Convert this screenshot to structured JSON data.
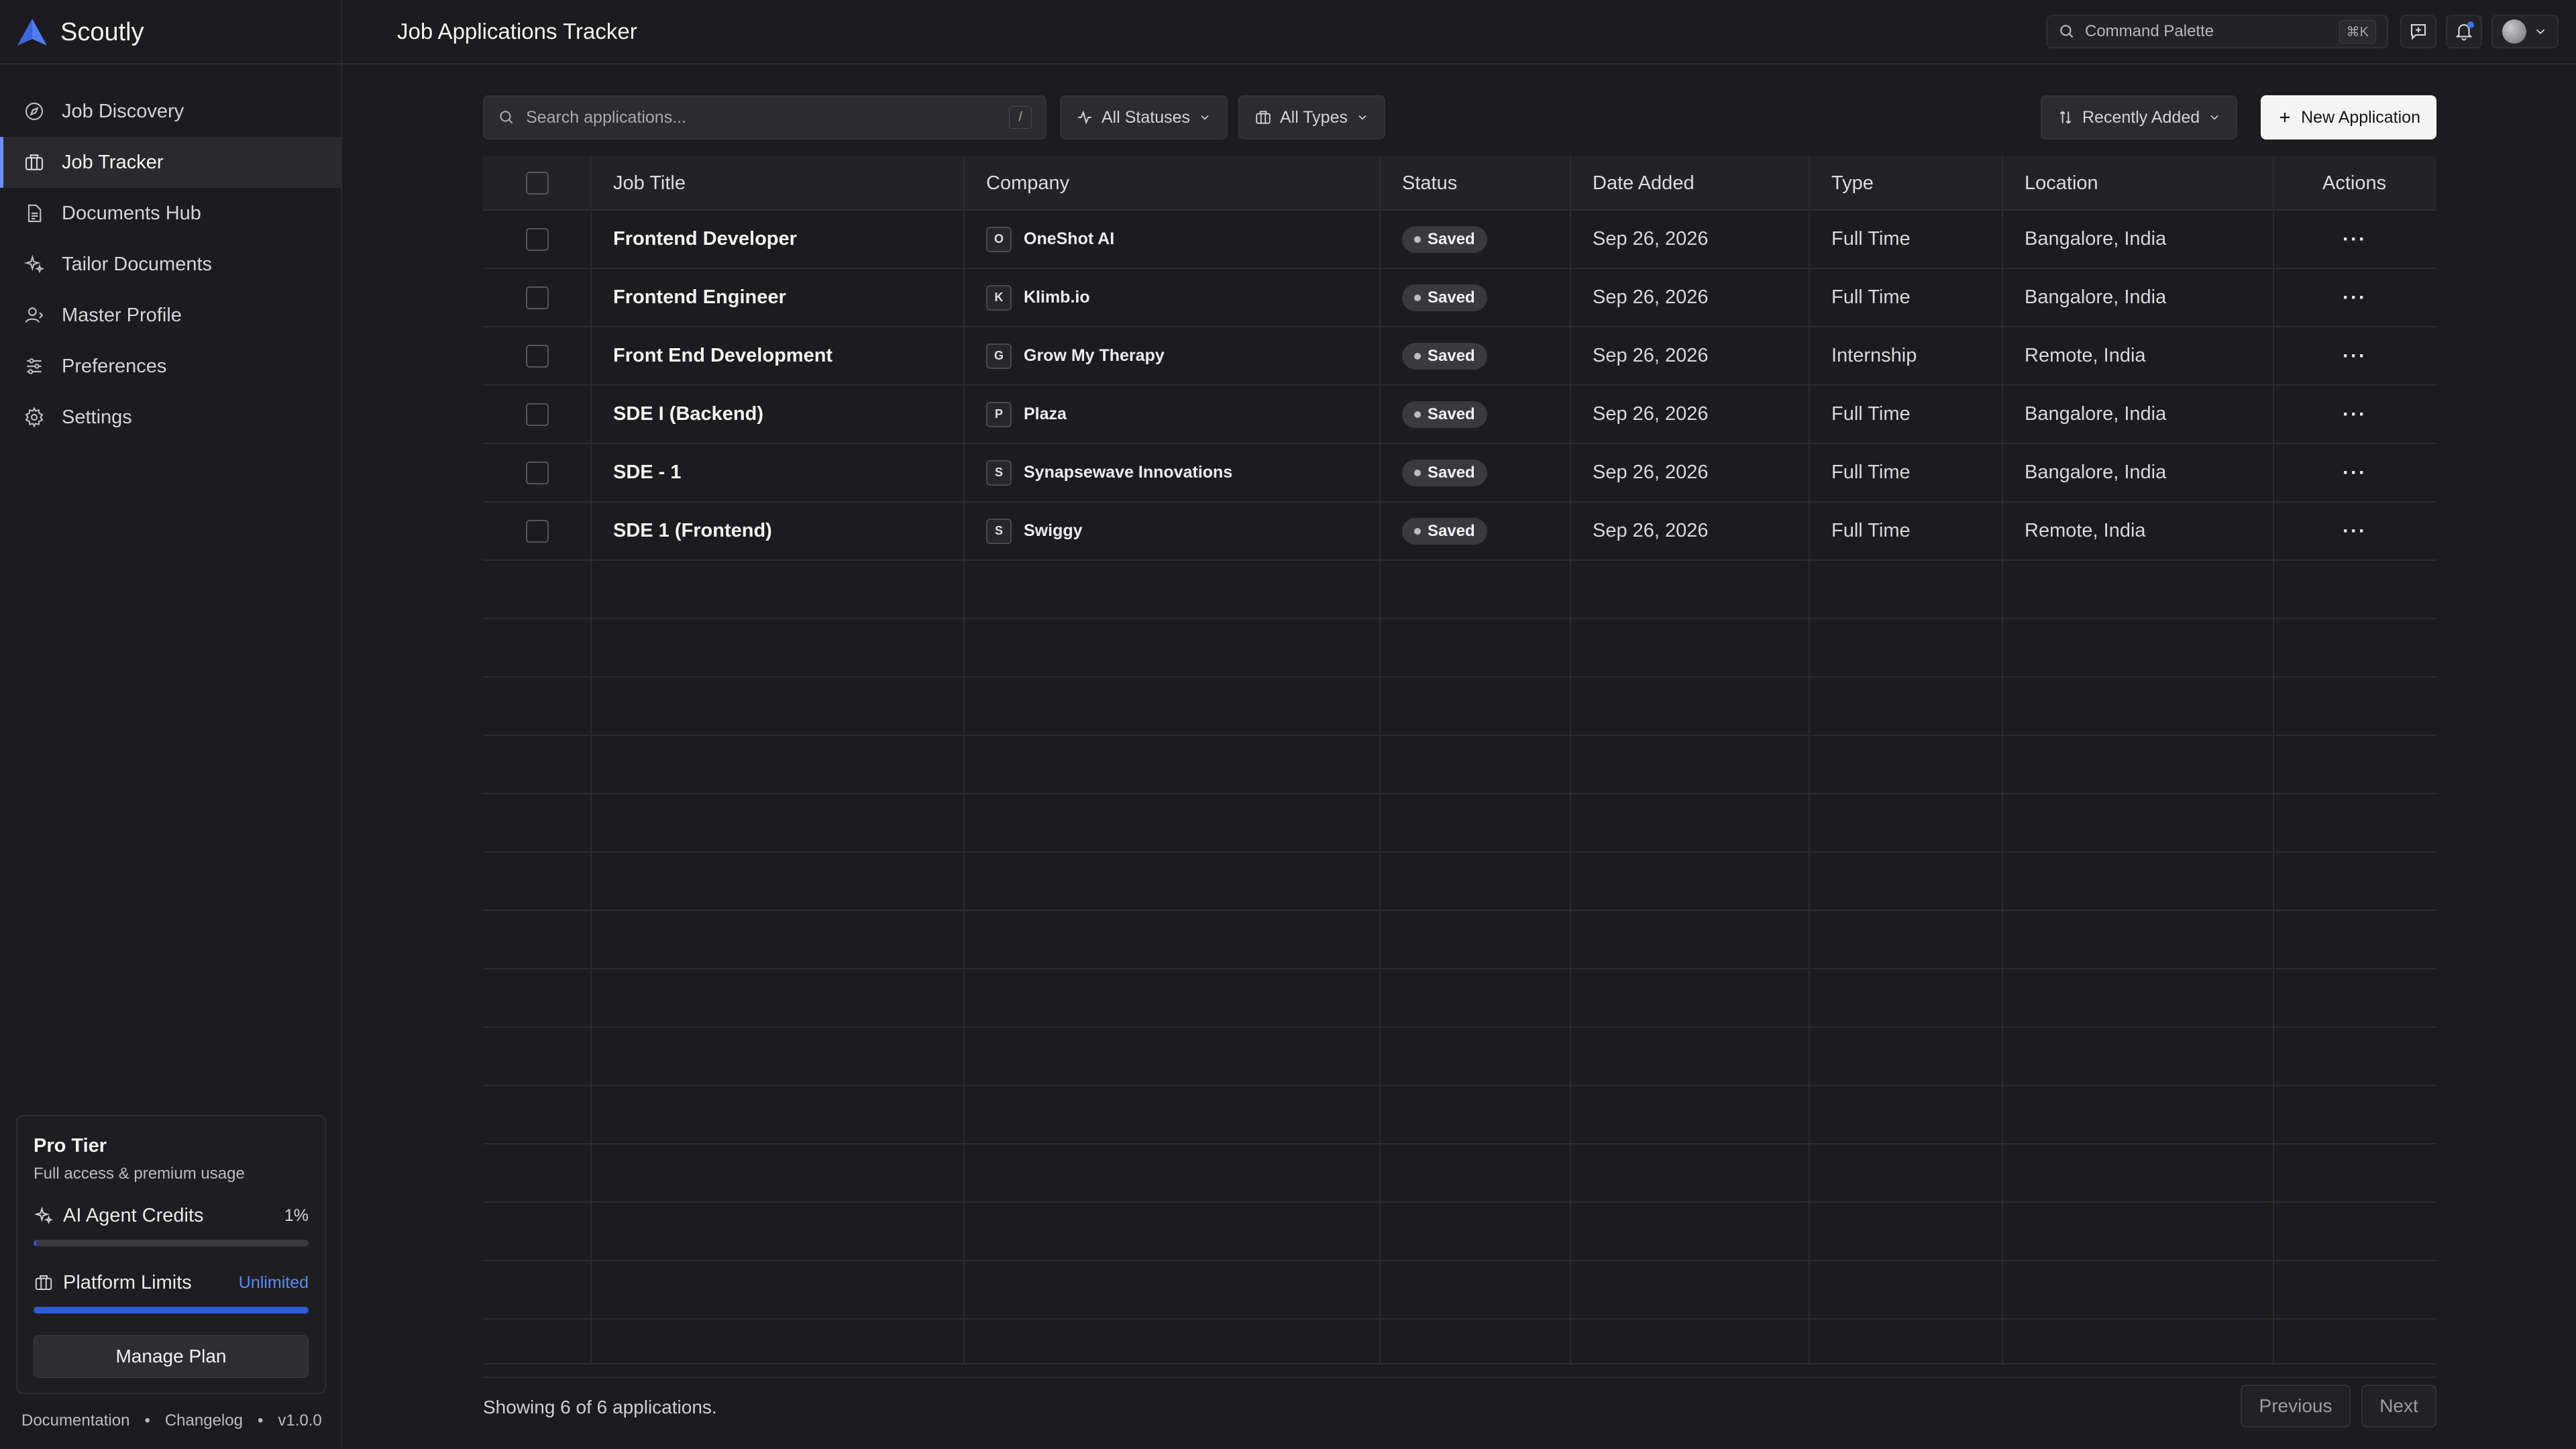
{
  "app": {
    "name": "Scoutly",
    "page_title": "Job Applications Tracker"
  },
  "topbar": {
    "command_palette": "Command Palette",
    "shortcut": "⌘K"
  },
  "sidebar": {
    "items": [
      {
        "label": "Job Discovery",
        "icon": "compass-icon",
        "active": false
      },
      {
        "label": "Job Tracker",
        "icon": "briefcase-icon",
        "active": true
      },
      {
        "label": "Documents Hub",
        "icon": "document-icon",
        "active": false
      },
      {
        "label": "Tailor Documents",
        "icon": "sparkles-icon",
        "active": false
      },
      {
        "label": "Master Profile",
        "icon": "user-icon",
        "active": false
      },
      {
        "label": "Preferences",
        "icon": "sliders-icon",
        "active": false
      },
      {
        "label": "Settings",
        "icon": "gear-icon",
        "active": false
      }
    ],
    "plan": {
      "title": "Pro Tier",
      "subtitle": "Full access & premium usage",
      "credits_label": "AI Agent Credits",
      "credits_value": "1%",
      "credits_fraction": 0.01,
      "limits_label": "Platform Limits",
      "limits_value": "Unlimited",
      "limits_fraction": 1.0,
      "manage_label": "Manage Plan"
    },
    "footer": {
      "docs": "Documentation",
      "sep": "•",
      "changelog": "Changelog",
      "version": "v1.0.0"
    }
  },
  "toolbar": {
    "search_placeholder": "Search applications...",
    "search_shortcut": "/",
    "status_filter": "All Statuses",
    "type_filter": "All Types",
    "sort": "Recently Added",
    "new_button": "New Application"
  },
  "table": {
    "columns": [
      "Job Title",
      "Company",
      "Status",
      "Date Added",
      "Type",
      "Location",
      "Actions"
    ],
    "rows": [
      {
        "title": "Frontend Developer",
        "company": "OneShot AI",
        "initial": "O",
        "status": "Saved",
        "date": "Sep 26, 2026",
        "type": "Full Time",
        "location": "Bangalore, India"
      },
      {
        "title": "Frontend Engineer",
        "company": "Klimb.io",
        "initial": "K",
        "status": "Saved",
        "date": "Sep 26, 2026",
        "type": "Full Time",
        "location": "Bangalore, India"
      },
      {
        "title": "Front End Development",
        "company": "Grow My Therapy",
        "initial": "G",
        "status": "Saved",
        "date": "Sep 26, 2026",
        "type": "Internship",
        "location": "Remote, India"
      },
      {
        "title": "SDE I (Backend)",
        "company": "Plaza",
        "initial": "P",
        "status": "Saved",
        "date": "Sep 26, 2026",
        "type": "Full Time",
        "location": "Bangalore, India"
      },
      {
        "title": "SDE - 1",
        "company": "Synapsewave Innovations",
        "initial": "S",
        "status": "Saved",
        "date": "Sep 26, 2026",
        "type": "Full Time",
        "location": "Bangalore, India"
      },
      {
        "title": "SDE 1 (Frontend)",
        "company": "Swiggy",
        "initial": "S",
        "status": "Saved",
        "date": "Sep 26, 2026",
        "type": "Full Time",
        "location": "Remote, India"
      }
    ],
    "actions_glyph": "···"
  },
  "pagination": {
    "summary": "Showing 6 of 6 applications.",
    "previous": "Previous",
    "next": "Next"
  },
  "colors": {
    "accent": "#6e8ffb",
    "progress": "#2f5bd7",
    "link": "#5b8bf5",
    "background": "#1c1c1e"
  }
}
